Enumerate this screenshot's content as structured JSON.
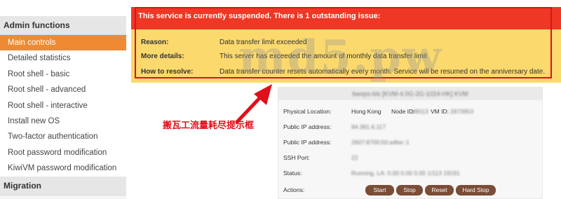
{
  "sidebar": {
    "section_admin": "Admin functions",
    "items": [
      "Main controls",
      "Detailed statistics",
      "Root shell - basic",
      "Root shell - advanced",
      "Root shell - interactive",
      "Install new OS",
      "Two-factor authentication",
      "Root password modification",
      "KiwiVM password modification"
    ],
    "active_index": 0,
    "section_migration": "Migration"
  },
  "alert": {
    "title": "This service is currently suspended. There is 1 outstanding issue:",
    "rows": [
      {
        "key": "Reason:",
        "value": "Data transfer limit exceeded"
      },
      {
        "key": "More details:",
        "value": "This server has exceeded the amount of monthly data transfer limit"
      },
      {
        "key": "How to resolve:",
        "value": "Data transfer counter resets automatically every month. Service will be resumed on the anniversary date."
      }
    ]
  },
  "watermark": "md5.pw",
  "annotation": "搬瓦工流量耗尽提示框",
  "panel": {
    "header": "bwvps-bls  [KVM-4.0G-2G-1024-HK]  KVM",
    "physical_location_label": "Physical Location:",
    "physical_location_value": "Hong Kong",
    "node_id_label": "Node ID:",
    "node_id_value": "#8013",
    "vm_id_label": "VM ID:",
    "vm_id_value": "2873953",
    "public_ip_label_1": "Public IP address:",
    "public_ip_value_1": "94.391.6.117",
    "public_ip_label_2": "Public IP address:",
    "public_ip_value_2": "2607:8700:50:a4be::1",
    "ssh_port_label": "SSH Port:",
    "ssh_port_value": "22",
    "status_label": "Status:",
    "status_value": "Running, LA: 0.00 0.00 0.00 1/113 19191",
    "actions_label": "Actions:",
    "buttons": [
      "Start",
      "Stop",
      "Reset",
      "Hard Stop"
    ]
  },
  "colors": {
    "accent": "#f08a32",
    "alert_red": "#ee3724",
    "alert_yellow": "#fbd96d",
    "annotation_red": "#e0101a",
    "button_brown": "#7b4c36"
  }
}
